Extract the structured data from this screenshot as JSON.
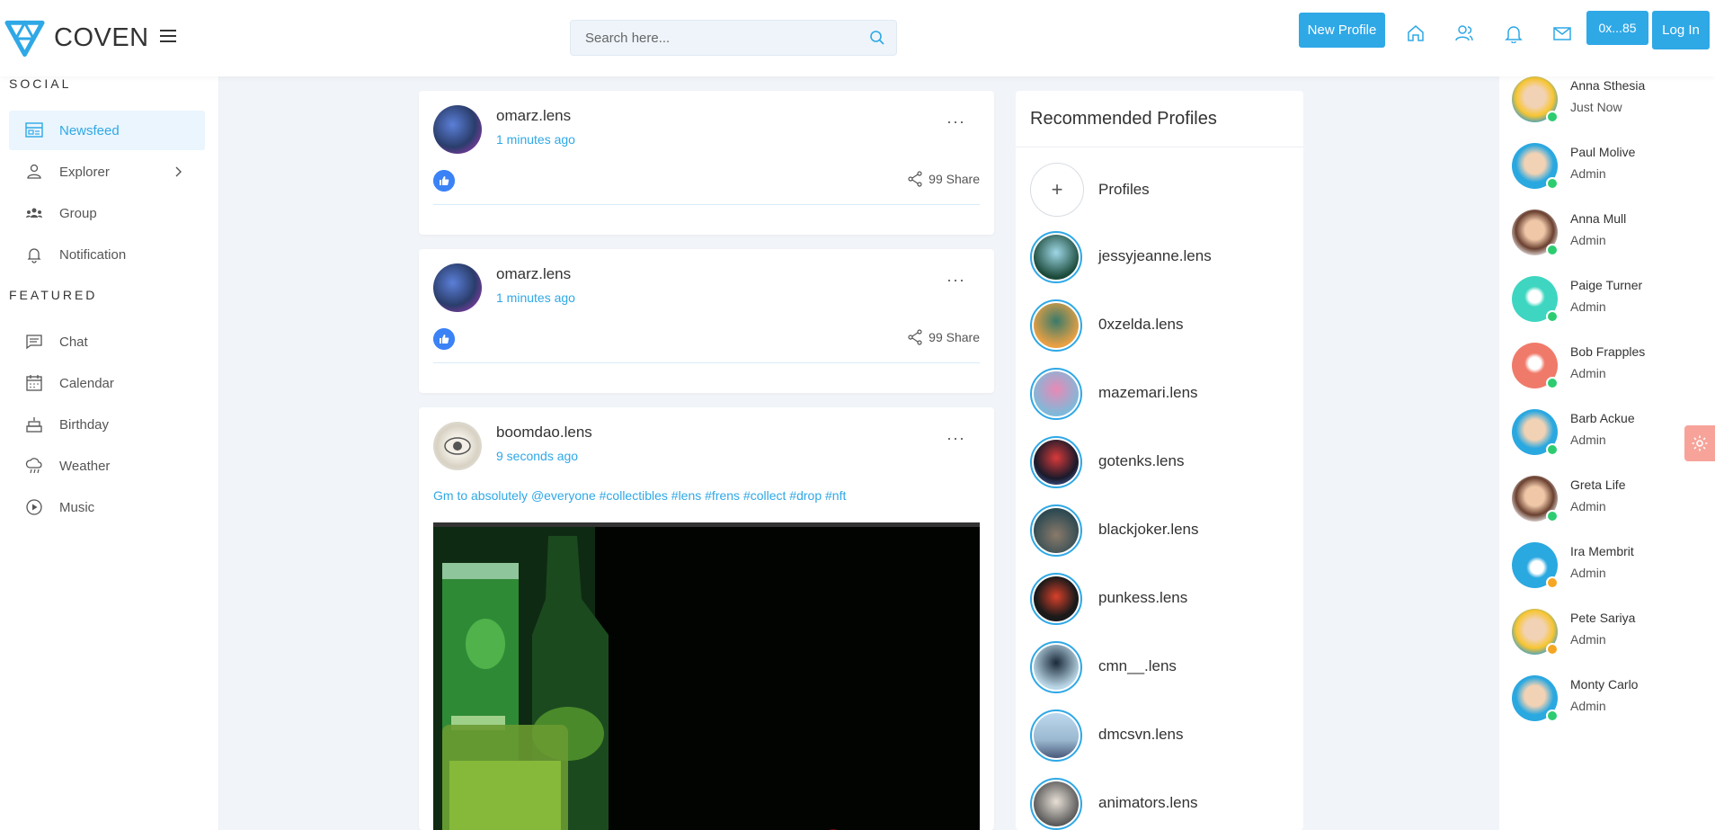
{
  "app": {
    "name": "COVEN",
    "accent": "#2fa8e6"
  },
  "header": {
    "search_placeholder": "Search here...",
    "new_profile_label": "New Profile",
    "address_label": "0x...85",
    "login_label": "Log In",
    "icons": [
      "home-icon",
      "users-icon",
      "bell-icon",
      "mail-icon"
    ]
  },
  "sidebar": {
    "social_title": "SOCIAL",
    "featured_title": "FEATURED",
    "social_items": [
      {
        "label": "Newsfeed",
        "icon": "newsfeed-icon",
        "active": true
      },
      {
        "label": "Explorer",
        "icon": "user-icon",
        "has_chevron": true
      },
      {
        "label": "Group",
        "icon": "group-icon"
      },
      {
        "label": "Notification",
        "icon": "bell-icon"
      }
    ],
    "featured_items": [
      {
        "label": "Chat",
        "icon": "chat-icon"
      },
      {
        "label": "Calendar",
        "icon": "calendar-icon"
      },
      {
        "label": "Birthday",
        "icon": "cake-icon"
      },
      {
        "label": "Weather",
        "icon": "cloud-rain-icon"
      },
      {
        "label": "Music",
        "icon": "play-icon"
      }
    ]
  },
  "feed": {
    "posts": [
      {
        "user": "omarz.lens",
        "time": "1 minutes ago",
        "share": "99 Share"
      },
      {
        "user": "omarz.lens",
        "time": "1 minutes ago",
        "share": "99 Share"
      },
      {
        "user": "boomdao.lens",
        "time": "9 seconds ago",
        "text": "Gm to absolutely @everyone #collectibles #lens #frens #collect #drop #nft"
      }
    ]
  },
  "recommended": {
    "title": "Recommended Profiles",
    "add_label": "Profiles",
    "profiles": [
      "jessyjeanne.lens",
      "0xzelda.lens",
      "mazemari.lens",
      "gotenks.lens",
      "blackjoker.lens",
      "punkess.lens",
      "cmn__.lens",
      "dmcsvn.lens",
      "animators.lens"
    ]
  },
  "contacts": [
    {
      "name": "Anna Sthesia",
      "role": "Just Now",
      "status_color": "#2ecc71"
    },
    {
      "name": "Paul Molive",
      "role": "Admin",
      "status_color": "#2ecc71"
    },
    {
      "name": "Anna Mull",
      "role": "Admin",
      "status_color": "#2ecc71"
    },
    {
      "name": "Paige Turner",
      "role": "Admin",
      "status_color": "#2ecc71"
    },
    {
      "name": "Bob Frapples",
      "role": "Admin",
      "status_color": "#2ecc71"
    },
    {
      "name": "Barb Ackue",
      "role": "Admin",
      "status_color": "#2ecc71"
    },
    {
      "name": "Greta Life",
      "role": "Admin",
      "status_color": "#2ecc71"
    },
    {
      "name": "Ira Membrit",
      "role": "Admin",
      "status_color": "#f5a623"
    },
    {
      "name": "Pete Sariya",
      "role": "Admin",
      "status_color": "#f5a623"
    },
    {
      "name": "Monty Carlo",
      "role": "Admin",
      "status_color": "#2ecc71"
    }
  ]
}
